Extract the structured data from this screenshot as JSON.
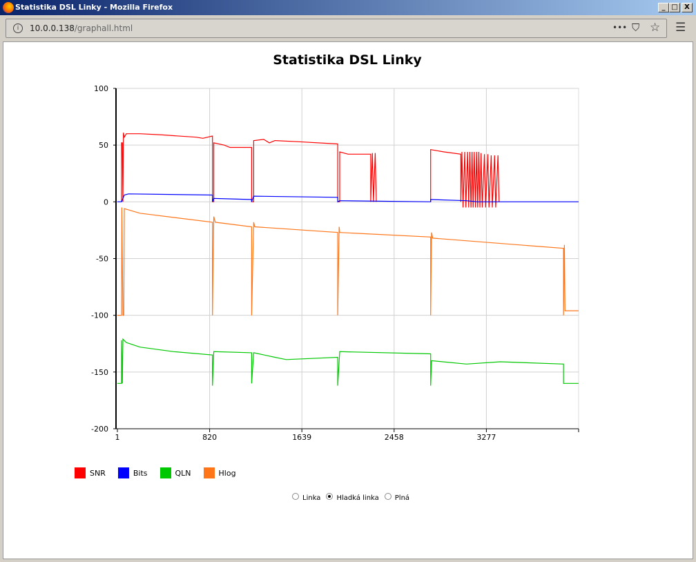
{
  "window": {
    "title": "Statistika DSL Linky - Mozilla Firefox",
    "min": "_",
    "max": "□",
    "close": "X"
  },
  "browser": {
    "url_host": "10.0.0.138",
    "url_path": "/graphall.html",
    "more": "•••",
    "pocket": "⛉",
    "star": "☆",
    "menu": "☰",
    "info": "i"
  },
  "chart_data": {
    "type": "line",
    "title": "Statistika DSL Linky",
    "xlabel": "",
    "ylabel": "",
    "xlim": [
      1,
      4096
    ],
    "ylim": [
      -200,
      100
    ],
    "xticks": [
      1,
      820,
      1639,
      2458,
      3277
    ],
    "yticks": [
      100,
      50,
      0,
      -50,
      -100,
      -150,
      -200
    ],
    "grid": true,
    "legend_position": "bottom-left",
    "series": [
      {
        "name": "SNR",
        "color": "#ff0000",
        "points": [
          [
            38,
            0
          ],
          [
            38,
            52
          ],
          [
            45,
            52
          ],
          [
            50,
            0
          ],
          [
            55,
            61
          ],
          [
            62,
            57
          ],
          [
            80,
            60
          ],
          [
            200,
            60
          ],
          [
            400,
            59
          ],
          [
            700,
            57
          ],
          [
            760,
            56
          ],
          [
            845,
            58
          ],
          [
            845,
            0
          ],
          [
            857,
            0
          ],
          [
            857,
            52
          ],
          [
            950,
            50
          ],
          [
            1000,
            48
          ],
          [
            1193,
            48
          ],
          [
            1193,
            0
          ],
          [
            1211,
            0
          ],
          [
            1211,
            54
          ],
          [
            1300,
            55
          ],
          [
            1350,
            52
          ],
          [
            1400,
            54
          ],
          [
            1600,
            53
          ],
          [
            1957,
            51
          ],
          [
            1957,
            0
          ],
          [
            1975,
            0
          ],
          [
            1975,
            44
          ],
          [
            2050,
            42
          ],
          [
            2250,
            42
          ],
          [
            2250,
            0
          ],
          [
            2265,
            43
          ],
          [
            2275,
            0
          ],
          [
            2290,
            43
          ],
          [
            2300,
            0
          ],
          null,
          [
            2782,
            0
          ],
          [
            2782,
            46
          ],
          [
            2900,
            44
          ],
          [
            3050,
            42
          ],
          [
            3050,
            0
          ],
          [
            3060,
            44
          ],
          [
            3070,
            -5
          ],
          [
            3085,
            44
          ],
          [
            3095,
            -5
          ],
          [
            3110,
            44
          ],
          [
            3120,
            -5
          ],
          [
            3130,
            44
          ],
          [
            3140,
            -5
          ],
          [
            3150,
            44
          ],
          [
            3160,
            -5
          ],
          [
            3170,
            44
          ],
          [
            3180,
            -5
          ],
          [
            3190,
            44
          ],
          [
            3200,
            -5
          ],
          [
            3210,
            44
          ],
          [
            3220,
            -5
          ],
          [
            3230,
            43
          ],
          [
            3240,
            -5
          ],
          [
            3260,
            42
          ],
          [
            3270,
            -5
          ],
          [
            3290,
            42
          ],
          [
            3300,
            -5
          ],
          [
            3320,
            41
          ],
          [
            3330,
            -5
          ],
          [
            3350,
            41
          ],
          [
            3360,
            -5
          ],
          [
            3380,
            41
          ],
          [
            3390,
            0
          ]
        ]
      },
      {
        "name": "Bits",
        "color": "#0000ff",
        "points": [
          [
            1,
            0
          ],
          [
            38,
            0
          ],
          [
            50,
            3
          ],
          [
            62,
            6
          ],
          [
            100,
            7
          ],
          [
            845,
            6
          ],
          [
            845,
            0
          ],
          [
            857,
            3
          ],
          [
            1193,
            2
          ],
          [
            1193,
            0
          ],
          [
            1211,
            5
          ],
          [
            1957,
            4
          ],
          [
            1957,
            0
          ],
          [
            1975,
            1
          ],
          [
            2782,
            0
          ],
          [
            2782,
            2
          ],
          [
            3100,
            1
          ],
          [
            3200,
            0
          ],
          [
            4096,
            0
          ]
        ]
      },
      {
        "name": "QLN",
        "color": "#00c800",
        "points": [
          [
            1,
            -160
          ],
          [
            38,
            -160
          ],
          [
            38,
            -122
          ],
          [
            45,
            -160
          ],
          [
            50,
            -121
          ],
          [
            80,
            -124
          ],
          [
            200,
            -128
          ],
          [
            500,
            -132
          ],
          [
            845,
            -135
          ],
          [
            845,
            -162
          ],
          [
            857,
            -132
          ],
          [
            1193,
            -133
          ],
          [
            1193,
            -160
          ],
          [
            1211,
            -133
          ],
          [
            1400,
            -137
          ],
          [
            1500,
            -139
          ],
          [
            1957,
            -137
          ],
          [
            1957,
            -162
          ],
          [
            1975,
            -132
          ],
          [
            2782,
            -134
          ],
          [
            2782,
            -162
          ],
          [
            2790,
            -140
          ],
          [
            3100,
            -143
          ],
          [
            3400,
            -141
          ],
          [
            3962,
            -143
          ],
          [
            3962,
            -160
          ],
          [
            4096,
            -160
          ]
        ]
      },
      {
        "name": "Hlog",
        "color": "#ff7518",
        "points": [
          [
            1,
            -100
          ],
          [
            38,
            -100
          ],
          [
            40,
            -5
          ],
          [
            50,
            -100
          ],
          [
            58,
            -100
          ],
          [
            62,
            -6
          ],
          [
            200,
            -10
          ],
          [
            845,
            -18
          ],
          [
            845,
            -100
          ],
          [
            857,
            -13
          ],
          [
            870,
            -18
          ],
          [
            1193,
            -22
          ],
          [
            1193,
            -100
          ],
          [
            1211,
            -18
          ],
          [
            1220,
            -22
          ],
          [
            1957,
            -27
          ],
          [
            1957,
            -100
          ],
          [
            1970,
            -22
          ],
          [
            1975,
            -27
          ],
          [
            2782,
            -31
          ],
          [
            2782,
            -100
          ],
          [
            2790,
            -27
          ],
          [
            2800,
            -32
          ],
          [
            3962,
            -41
          ],
          [
            3962,
            -100
          ],
          [
            3970,
            -38
          ],
          [
            3975,
            -96
          ],
          [
            4096,
            -96
          ]
        ]
      }
    ]
  },
  "radios": [
    {
      "label": "Linka",
      "checked": false
    },
    {
      "label": "Hladká linka",
      "checked": true
    },
    {
      "label": "Plná",
      "checked": false
    }
  ]
}
